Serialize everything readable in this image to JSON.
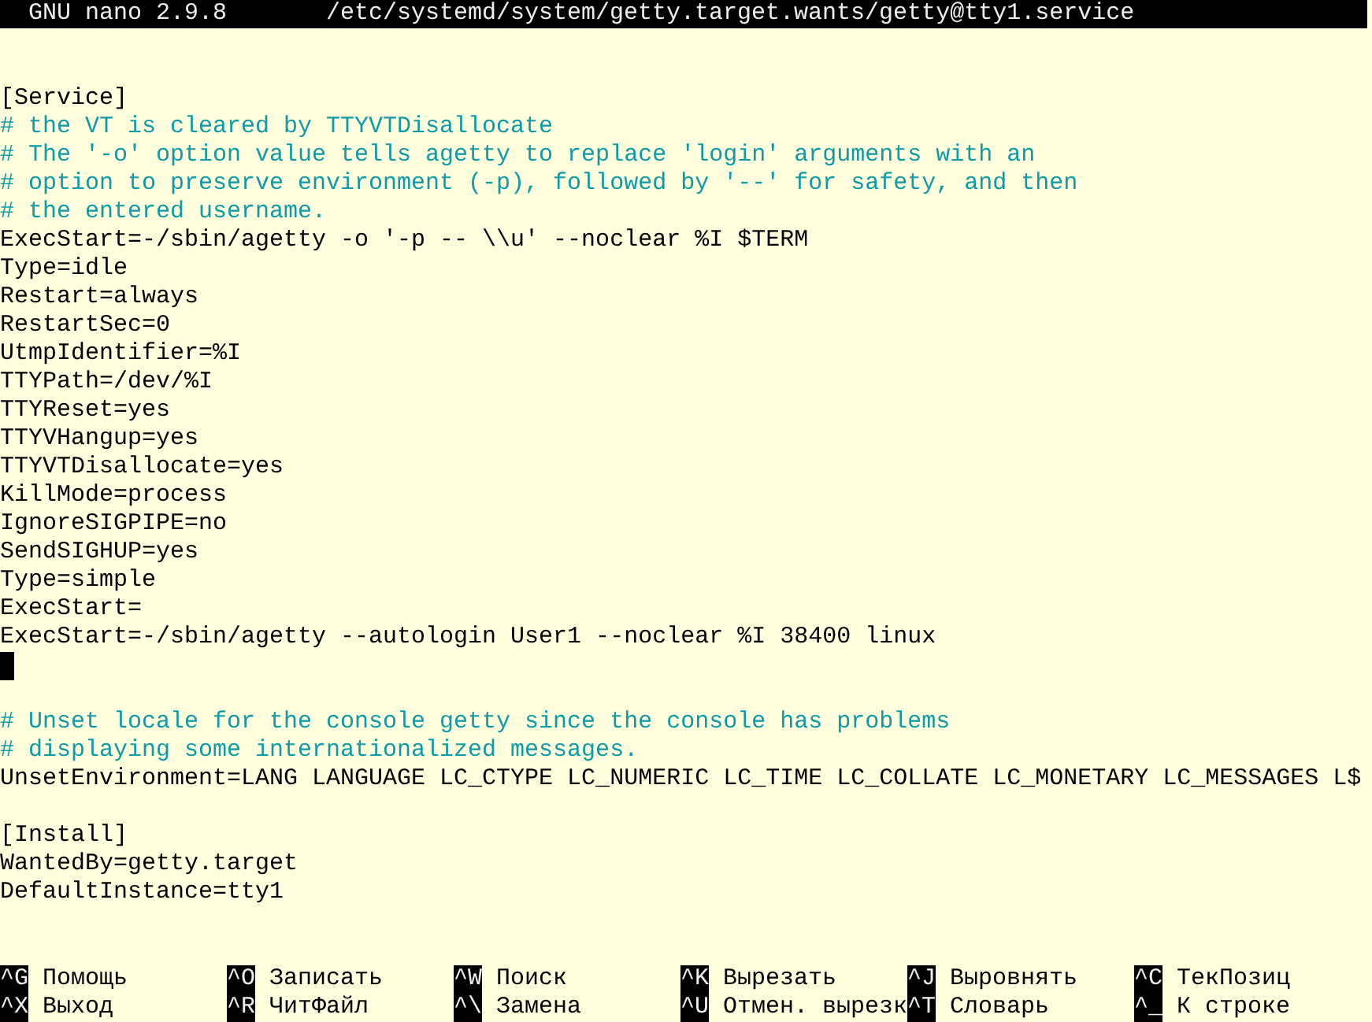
{
  "title_bar": {
    "app": "GNU nano 2.9.8",
    "file": "/etc/systemd/system/getty.target.wants/getty@tty1.service"
  },
  "lines": [
    {
      "kind": "blank"
    },
    {
      "kind": "blank"
    },
    {
      "kind": "code",
      "text": "[Service]"
    },
    {
      "kind": "comment",
      "text": "# the VT is cleared by TTYVTDisallocate"
    },
    {
      "kind": "comment",
      "text": "# The '-o' option value tells agetty to replace 'login' arguments with an"
    },
    {
      "kind": "comment",
      "text": "# option to preserve environment (-p), followed by '--' for safety, and then"
    },
    {
      "kind": "comment",
      "text": "# the entered username."
    },
    {
      "kind": "code",
      "text": "ExecStart=-/sbin/agetty -o '-p -- \\\\u' --noclear %I $TERM"
    },
    {
      "kind": "code",
      "text": "Type=idle"
    },
    {
      "kind": "code",
      "text": "Restart=always"
    },
    {
      "kind": "code",
      "text": "RestartSec=0"
    },
    {
      "kind": "code",
      "text": "UtmpIdentifier=%I"
    },
    {
      "kind": "code",
      "text": "TTYPath=/dev/%I"
    },
    {
      "kind": "code",
      "text": "TTYReset=yes"
    },
    {
      "kind": "code",
      "text": "TTYVHangup=yes"
    },
    {
      "kind": "code",
      "text": "TTYVTDisallocate=yes"
    },
    {
      "kind": "code",
      "text": "KillMode=process"
    },
    {
      "kind": "code",
      "text": "IgnoreSIGPIPE=no"
    },
    {
      "kind": "code",
      "text": "SendSIGHUP=yes"
    },
    {
      "kind": "code",
      "text": "Type=simple"
    },
    {
      "kind": "code",
      "text": "ExecStart="
    },
    {
      "kind": "code",
      "text": "ExecStart=-/sbin/agetty --autologin User1 --noclear %I 38400 linux"
    },
    {
      "kind": "cursor"
    },
    {
      "kind": "blank"
    },
    {
      "kind": "comment",
      "text": "# Unset locale for the console getty since the console has problems"
    },
    {
      "kind": "comment",
      "text": "# displaying some internationalized messages."
    },
    {
      "kind": "code",
      "text": "UnsetEnvironment=LANG LANGUAGE LC_CTYPE LC_NUMERIC LC_TIME LC_COLLATE LC_MONETARY LC_MESSAGES L$"
    },
    {
      "kind": "blank"
    },
    {
      "kind": "code",
      "text": "[Install]"
    },
    {
      "kind": "code",
      "text": "WantedBy=getty.target"
    },
    {
      "kind": "code",
      "text": "DefaultInstance=tty1"
    }
  ],
  "shortcuts": [
    [
      {
        "key": "^G",
        "label": "Помощь"
      },
      {
        "key": "^O",
        "label": "Записать"
      },
      {
        "key": "^W",
        "label": "Поиск"
      },
      {
        "key": "^K",
        "label": "Вырезать"
      },
      {
        "key": "^J",
        "label": "Выровнять"
      },
      {
        "key": "^C",
        "label": "ТекПозиц"
      }
    ],
    [
      {
        "key": "^X",
        "label": "Выход"
      },
      {
        "key": "^R",
        "label": "ЧитФайл"
      },
      {
        "key": "^\\",
        "label": "Замена"
      },
      {
        "key": "^U",
        "label": "Отмен. вырезк"
      },
      {
        "key": "^T",
        "label": "Словарь"
      },
      {
        "key": "^_",
        "label": "К строке"
      }
    ]
  ]
}
